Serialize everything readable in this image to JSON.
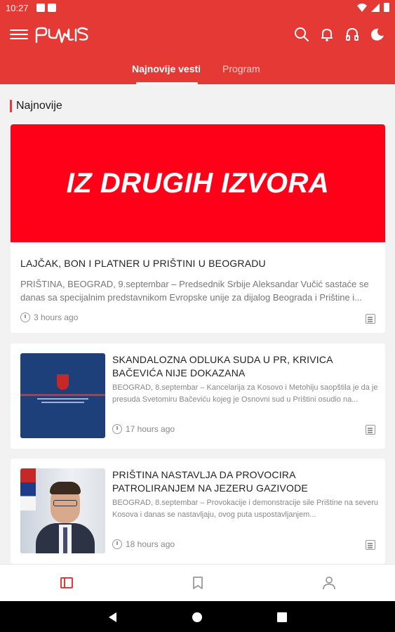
{
  "status_bar": {
    "time": "10:27"
  },
  "app": {
    "tabs": [
      {
        "label": "Najnovije vesti",
        "active": true
      },
      {
        "label": "Program",
        "active": false
      }
    ],
    "top_icons": [
      "search-icon",
      "bell-icon",
      "headphones-icon",
      "dark-mode-icon"
    ]
  },
  "section": {
    "title": "Najnovije"
  },
  "hero": {
    "image_text": "IZ DRUGIH IZVORA",
    "title": "LAJČAK, BON I PLATNER U PRIŠTINI U BEOGRADU",
    "excerpt": "PRIŠTINA, BEOGRAD, 9.septembar – Predsednik Srbije Aleksandar Vučić sastaće se danas sa specijalnim predstavnikom Evropske unije za dijalog Beograda i Prištine i...",
    "time": "3 hours ago"
  },
  "articles": [
    {
      "title": "SKANDALOZNA ODLUKA SUDA U PR, KRIVICA BAČEVIĆA NIJE DOKAZANA",
      "excerpt": "BEOGRAD, 8.septembar – Kancelarija za Kosovo i Metohiju saopštila je da je presuda Svetomiru Bačeviću kojeg je Osnovni sud u Prištini osudio na...",
      "time": "17 hours ago"
    },
    {
      "title": "PRIŠTINA NASTAVLJA DA PROVOCIRA PATROLIRANJEM NA JEZERU GAZIVODE",
      "excerpt": "BEOGRAD, 8.septembar – Provokacije i demonstracije sile Prištine na severu Kosova i danas se nastavljaju, ovog puta uspostavljanjem...",
      "time": "18 hours ago"
    }
  ],
  "colors": {
    "brand_red": "#e53935",
    "hero_red": "#ff0018"
  }
}
